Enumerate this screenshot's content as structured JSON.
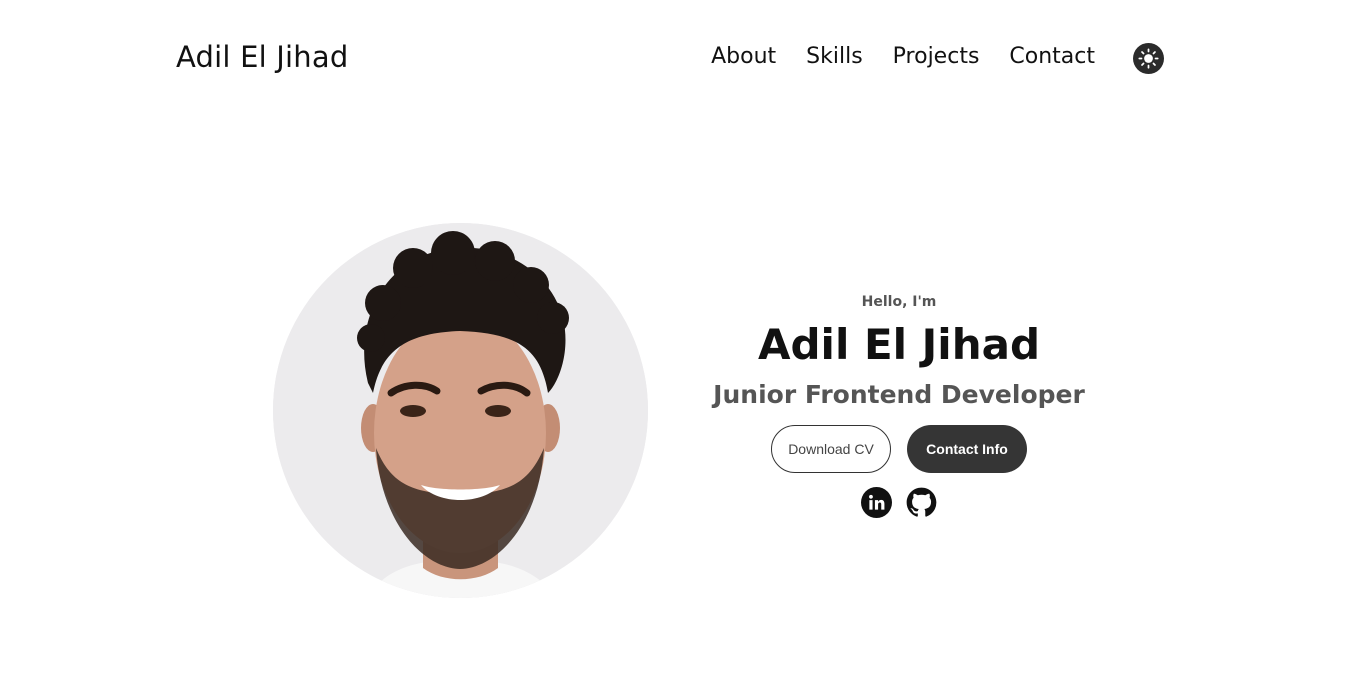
{
  "header": {
    "logo": "Adil El Jihad",
    "nav": [
      {
        "label": "About"
      },
      {
        "label": "Skills"
      },
      {
        "label": "Projects"
      },
      {
        "label": "Contact"
      }
    ],
    "theme_toggle_icon": "sun-icon"
  },
  "hero": {
    "greeting": "Hello, I'm",
    "name": "Adil El Jihad",
    "role": "Junior Frontend Developer",
    "buttons": {
      "download_cv": "Download CV",
      "contact_info": "Contact Info"
    },
    "socials": [
      {
        "icon": "linkedin-icon"
      },
      {
        "icon": "github-icon"
      }
    ],
    "photo_icon": "profile-photo"
  },
  "colors": {
    "text": "#111111",
    "muted": "#555555",
    "button_dark": "#353535",
    "background": "#ffffff"
  }
}
